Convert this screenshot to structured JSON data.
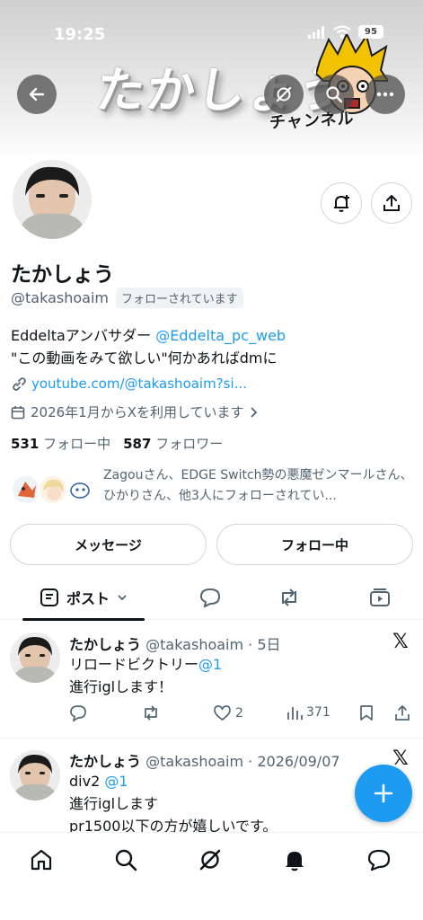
{
  "status_bar": {
    "time": "19:25",
    "battery": "95"
  },
  "banner": {
    "title_art": "たかしょう",
    "subtitle_art": "チャンネル"
  },
  "profile": {
    "display_name": "たかしょう",
    "handle": "@takashoaim",
    "follows_you": "フォローされています",
    "bio_line1_text": "Eddeltaアンバサダー ",
    "bio_line1_link": "@Eddelta_pc_web",
    "bio_line2": "\"この動画をみて欲しい\"何かあればdmに",
    "website": "youtube.com/@takashoaim?si...",
    "joined": "2026年1月からXを利用しています",
    "following_count": "531",
    "following_label": "フォロー中",
    "followers_count": "587",
    "followers_label": "フォロワー",
    "followed_by": "Zagouさん、EDGE Switch勢の悪魔ゼンマールさん、ひかりさん、他3人にフォローされてい..."
  },
  "actions": {
    "message": "メッセージ",
    "following": "フォロー中"
  },
  "tabs": {
    "posts": "ポスト"
  },
  "posts": [
    {
      "name": "たかしょう",
      "meta": "@takashoaim · 5日",
      "line1_text": "リロードビクトリー",
      "line1_link": "@1",
      "line2": "進行iglします！",
      "likes": "2",
      "views": "371"
    },
    {
      "name": "たかしょう",
      "meta": "@takashoaim · 2026/09/07",
      "line1_text": "div2 ",
      "line1_link": "@1",
      "line2": "進行iglします",
      "line3": "pr1500以下の方が嬉しいです。"
    }
  ],
  "colors": {
    "accent": "#1d9bf0",
    "text": "#0f1419",
    "muted": "#536471",
    "border": "#cfd9de"
  },
  "icons": [
    "back-arrow-icon",
    "grok-icon",
    "search-icon",
    "more-icon",
    "notification-bell-icon",
    "share-icon",
    "link-icon",
    "calendar-icon",
    "chevron-right-icon",
    "posts-icon",
    "chevron-down-icon",
    "reply-icon",
    "repost-icon",
    "like-icon",
    "views-icon",
    "bookmark-icon",
    "x-logo-icon",
    "compose-plus-icon",
    "home-icon",
    "notifications-icon",
    "messages-icon"
  ]
}
